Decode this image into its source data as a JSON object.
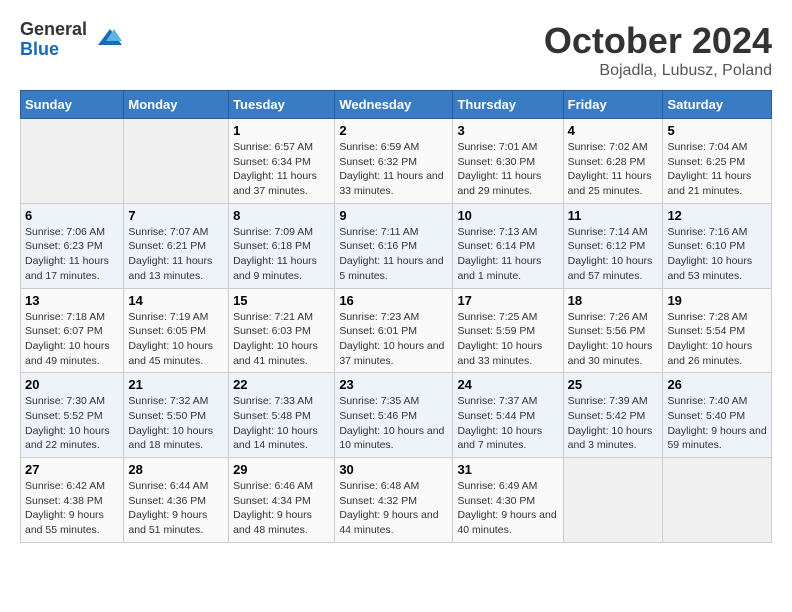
{
  "logo": {
    "general": "General",
    "blue": "Blue"
  },
  "title": "October 2024",
  "subtitle": "Bojadla, Lubusz, Poland",
  "days_of_week": [
    "Sunday",
    "Monday",
    "Tuesday",
    "Wednesday",
    "Thursday",
    "Friday",
    "Saturday"
  ],
  "weeks": [
    [
      {
        "day": "",
        "sunrise": "",
        "sunset": "",
        "daylight": ""
      },
      {
        "day": "",
        "sunrise": "",
        "sunset": "",
        "daylight": ""
      },
      {
        "day": "1",
        "sunrise": "Sunrise: 6:57 AM",
        "sunset": "Sunset: 6:34 PM",
        "daylight": "Daylight: 11 hours and 37 minutes."
      },
      {
        "day": "2",
        "sunrise": "Sunrise: 6:59 AM",
        "sunset": "Sunset: 6:32 PM",
        "daylight": "Daylight: 11 hours and 33 minutes."
      },
      {
        "day": "3",
        "sunrise": "Sunrise: 7:01 AM",
        "sunset": "Sunset: 6:30 PM",
        "daylight": "Daylight: 11 hours and 29 minutes."
      },
      {
        "day": "4",
        "sunrise": "Sunrise: 7:02 AM",
        "sunset": "Sunset: 6:28 PM",
        "daylight": "Daylight: 11 hours and 25 minutes."
      },
      {
        "day": "5",
        "sunrise": "Sunrise: 7:04 AM",
        "sunset": "Sunset: 6:25 PM",
        "daylight": "Daylight: 11 hours and 21 minutes."
      }
    ],
    [
      {
        "day": "6",
        "sunrise": "Sunrise: 7:06 AM",
        "sunset": "Sunset: 6:23 PM",
        "daylight": "Daylight: 11 hours and 17 minutes."
      },
      {
        "day": "7",
        "sunrise": "Sunrise: 7:07 AM",
        "sunset": "Sunset: 6:21 PM",
        "daylight": "Daylight: 11 hours and 13 minutes."
      },
      {
        "day": "8",
        "sunrise": "Sunrise: 7:09 AM",
        "sunset": "Sunset: 6:18 PM",
        "daylight": "Daylight: 11 hours and 9 minutes."
      },
      {
        "day": "9",
        "sunrise": "Sunrise: 7:11 AM",
        "sunset": "Sunset: 6:16 PM",
        "daylight": "Daylight: 11 hours and 5 minutes."
      },
      {
        "day": "10",
        "sunrise": "Sunrise: 7:13 AM",
        "sunset": "Sunset: 6:14 PM",
        "daylight": "Daylight: 11 hours and 1 minute."
      },
      {
        "day": "11",
        "sunrise": "Sunrise: 7:14 AM",
        "sunset": "Sunset: 6:12 PM",
        "daylight": "Daylight: 10 hours and 57 minutes."
      },
      {
        "day": "12",
        "sunrise": "Sunrise: 7:16 AM",
        "sunset": "Sunset: 6:10 PM",
        "daylight": "Daylight: 10 hours and 53 minutes."
      }
    ],
    [
      {
        "day": "13",
        "sunrise": "Sunrise: 7:18 AM",
        "sunset": "Sunset: 6:07 PM",
        "daylight": "Daylight: 10 hours and 49 minutes."
      },
      {
        "day": "14",
        "sunrise": "Sunrise: 7:19 AM",
        "sunset": "Sunset: 6:05 PM",
        "daylight": "Daylight: 10 hours and 45 minutes."
      },
      {
        "day": "15",
        "sunrise": "Sunrise: 7:21 AM",
        "sunset": "Sunset: 6:03 PM",
        "daylight": "Daylight: 10 hours and 41 minutes."
      },
      {
        "day": "16",
        "sunrise": "Sunrise: 7:23 AM",
        "sunset": "Sunset: 6:01 PM",
        "daylight": "Daylight: 10 hours and 37 minutes."
      },
      {
        "day": "17",
        "sunrise": "Sunrise: 7:25 AM",
        "sunset": "Sunset: 5:59 PM",
        "daylight": "Daylight: 10 hours and 33 minutes."
      },
      {
        "day": "18",
        "sunrise": "Sunrise: 7:26 AM",
        "sunset": "Sunset: 5:56 PM",
        "daylight": "Daylight: 10 hours and 30 minutes."
      },
      {
        "day": "19",
        "sunrise": "Sunrise: 7:28 AM",
        "sunset": "Sunset: 5:54 PM",
        "daylight": "Daylight: 10 hours and 26 minutes."
      }
    ],
    [
      {
        "day": "20",
        "sunrise": "Sunrise: 7:30 AM",
        "sunset": "Sunset: 5:52 PM",
        "daylight": "Daylight: 10 hours and 22 minutes."
      },
      {
        "day": "21",
        "sunrise": "Sunrise: 7:32 AM",
        "sunset": "Sunset: 5:50 PM",
        "daylight": "Daylight: 10 hours and 18 minutes."
      },
      {
        "day": "22",
        "sunrise": "Sunrise: 7:33 AM",
        "sunset": "Sunset: 5:48 PM",
        "daylight": "Daylight: 10 hours and 14 minutes."
      },
      {
        "day": "23",
        "sunrise": "Sunrise: 7:35 AM",
        "sunset": "Sunset: 5:46 PM",
        "daylight": "Daylight: 10 hours and 10 minutes."
      },
      {
        "day": "24",
        "sunrise": "Sunrise: 7:37 AM",
        "sunset": "Sunset: 5:44 PM",
        "daylight": "Daylight: 10 hours and 7 minutes."
      },
      {
        "day": "25",
        "sunrise": "Sunrise: 7:39 AM",
        "sunset": "Sunset: 5:42 PM",
        "daylight": "Daylight: 10 hours and 3 minutes."
      },
      {
        "day": "26",
        "sunrise": "Sunrise: 7:40 AM",
        "sunset": "Sunset: 5:40 PM",
        "daylight": "Daylight: 9 hours and 59 minutes."
      }
    ],
    [
      {
        "day": "27",
        "sunrise": "Sunrise: 6:42 AM",
        "sunset": "Sunset: 4:38 PM",
        "daylight": "Daylight: 9 hours and 55 minutes."
      },
      {
        "day": "28",
        "sunrise": "Sunrise: 6:44 AM",
        "sunset": "Sunset: 4:36 PM",
        "daylight": "Daylight: 9 hours and 51 minutes."
      },
      {
        "day": "29",
        "sunrise": "Sunrise: 6:46 AM",
        "sunset": "Sunset: 4:34 PM",
        "daylight": "Daylight: 9 hours and 48 minutes."
      },
      {
        "day": "30",
        "sunrise": "Sunrise: 6:48 AM",
        "sunset": "Sunset: 4:32 PM",
        "daylight": "Daylight: 9 hours and 44 minutes."
      },
      {
        "day": "31",
        "sunrise": "Sunrise: 6:49 AM",
        "sunset": "Sunset: 4:30 PM",
        "daylight": "Daylight: 9 hours and 40 minutes."
      },
      {
        "day": "",
        "sunrise": "",
        "sunset": "",
        "daylight": ""
      },
      {
        "day": "",
        "sunrise": "",
        "sunset": "",
        "daylight": ""
      }
    ]
  ]
}
